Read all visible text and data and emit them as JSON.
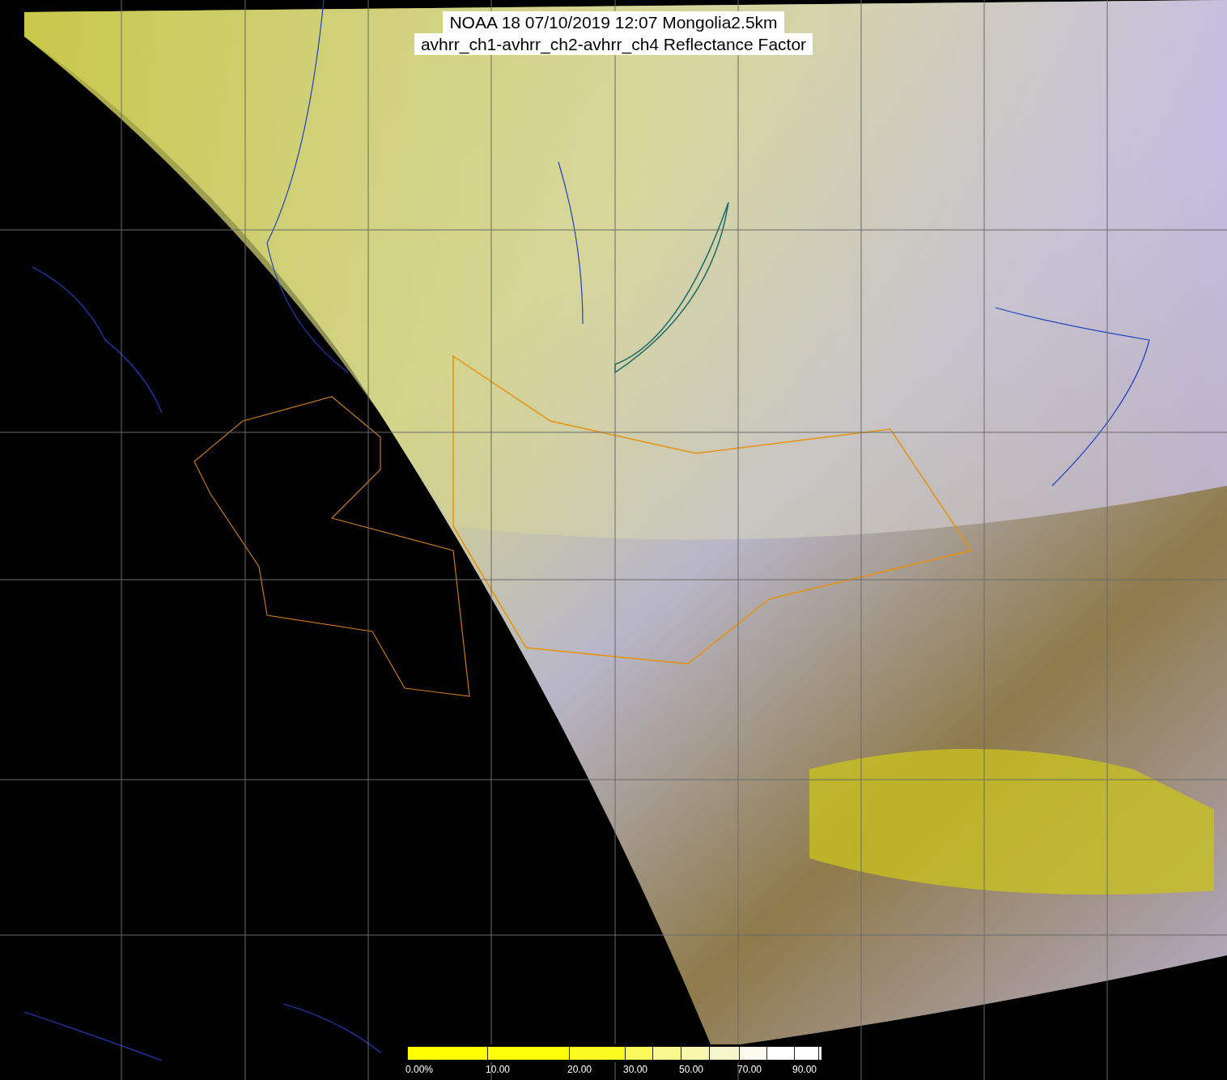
{
  "title": {
    "lines": [
      "NOAA 18 07/10/2019 12:07 Mongolia2.5km",
      "avhrr_ch1-avhrr_ch2-avhrr_ch4 Reflectance Factor"
    ]
  },
  "colorbar": {
    "segments": [
      {
        "color": "#ffff00",
        "label": "0.00%"
      },
      {
        "color": "#ffff08",
        "label": "10.00"
      },
      {
        "color": "#fbfb22",
        "label": "20.00"
      },
      {
        "color": "#f9f95c",
        "label": "30.00"
      },
      {
        "color": "#f8f88e"
      },
      {
        "color": "#f7f7ae",
        "label": "50.00"
      },
      {
        "color": "#f5f5cc"
      },
      {
        "color": "#fafaee",
        "label": "70.00"
      },
      {
        "color": "#ffffff"
      },
      {
        "color": "#fefefe",
        "label": "90.00"
      },
      {
        "color": "#f4f4f4"
      }
    ]
  }
}
